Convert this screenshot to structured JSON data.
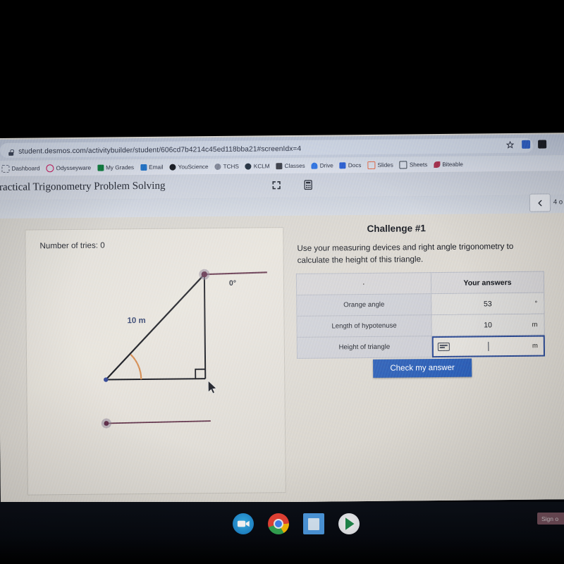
{
  "browser": {
    "url": "student.desmos.com/activitybuilder/student/606cd7b4214c45ed118bba21#screenIdx=4",
    "lock_icon": "lock-icon",
    "star_icon": "bookmark-star-icon",
    "bookmarks": [
      {
        "label": "Dashboard",
        "icon": "dashboard-icon",
        "color": "#e8e6e0"
      },
      {
        "label": "Odysseyware",
        "icon": "odysseyware-icon",
        "color": "#c2185b"
      },
      {
        "label": "My Grades",
        "icon": "my-grades-icon",
        "color": "#0f7a3d"
      },
      {
        "label": "Email",
        "icon": "email-icon",
        "color": "#1f6fc4"
      },
      {
        "label": "YouScience",
        "icon": "youscience-icon",
        "color": "#15181f"
      },
      {
        "label": "TCHS",
        "icon": "tchs-icon",
        "color": "#7e8494"
      },
      {
        "label": "KCLM",
        "icon": "kclm-icon",
        "color": "#23303f"
      },
      {
        "label": "Classes",
        "icon": "classes-icon",
        "color": "#3b3f49"
      },
      {
        "label": "Drive",
        "icon": "drive-icon",
        "color": "#2f72e0"
      },
      {
        "label": "Docs",
        "icon": "docs-icon",
        "color": "#2b5fd0"
      },
      {
        "label": "Slides",
        "icon": "slides-icon",
        "color": "#e06a4a"
      },
      {
        "label": "Sheets",
        "icon": "sheets-icon",
        "color": "#3c4450"
      },
      {
        "label": "Biteable",
        "icon": "biteable-icon",
        "color": "#a8324f"
      }
    ]
  },
  "activity": {
    "title": "Practical Trigonometry Problem Solving",
    "fullscreen_icon": "fullscreen-expand-icon",
    "calculator_icon": "calculator-icon",
    "prev_icon": "chevron-left-icon",
    "screen_counter": "4 o"
  },
  "graph_panel": {
    "tries_label": "Number of tries: 0",
    "hypotenuse_label": "10 m",
    "protractor_reading": "0°",
    "accent_orange": "#d2874a",
    "vertex_purple": "#6b3a5e",
    "line_dark": "#101218",
    "label_blue": "#2a3a66"
  },
  "challenge": {
    "heading": "Challenge #1",
    "prompt": "Use your measuring devices and right angle trigonometry to calculate the height of this triangle.",
    "check_button": "Check my answer",
    "check_button_color": "#2b5eb5",
    "table": {
      "headers": [
        "·",
        "Your answers"
      ],
      "rows": [
        {
          "label": "Orange angle",
          "value": "53",
          "unit": "°",
          "active": false
        },
        {
          "label": "Length of hypotenuse",
          "value": "10",
          "unit": "m",
          "active": false
        },
        {
          "label": "Height of triangle",
          "value": "",
          "unit": "m",
          "active": true,
          "keyboard_icon": "keyboard-toggle-icon"
        }
      ]
    }
  },
  "shelf": {
    "icons": [
      {
        "name": "video-camera-icon",
        "color": "#29a0dd"
      },
      {
        "name": "chrome-icon",
        "color": "#f2f2f2"
      },
      {
        "name": "google-docs-icon",
        "color": "#4e9ae0"
      },
      {
        "name": "play-store-icon",
        "color": "#eceff3"
      }
    ],
    "signout_label": "Sign o"
  }
}
